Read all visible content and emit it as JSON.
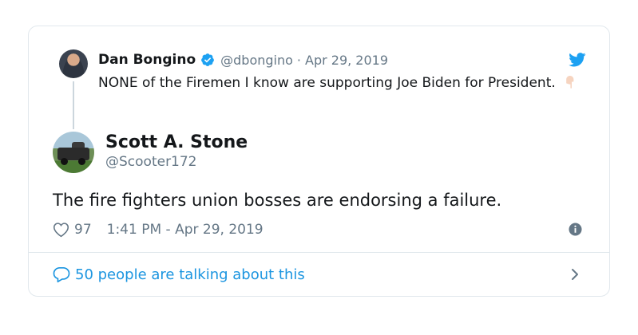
{
  "colors": {
    "twitter_blue": "#1da1f2",
    "link_blue": "#1b95e0",
    "text": "#14171a",
    "muted": "#657786",
    "border": "#e1e8ed"
  },
  "icons": {
    "logo": "twitter-bird-icon",
    "verified": "verified-badge-icon",
    "emoji": "backhand-index-pointing-down-emoji",
    "like": "heart-icon",
    "info": "info-icon",
    "reply": "speech-bubble-icon",
    "more": "chevron-right-icon"
  },
  "parent_tweet": {
    "name": "Dan Bongino",
    "handle": "@dbongino",
    "separator": "·",
    "date": "Apr 29, 2019",
    "text": "NONE of the Firemen I know are supporting Joe Biden for President."
  },
  "tweet": {
    "name": "Scott A. Stone",
    "handle": "@Scooter172",
    "text": "The fire fighters union bosses are endorsing a failure.",
    "likes": "97",
    "timestamp": "1:41 PM - Apr 29, 2019"
  },
  "footer": {
    "talking_label": "50 people are talking about this"
  }
}
